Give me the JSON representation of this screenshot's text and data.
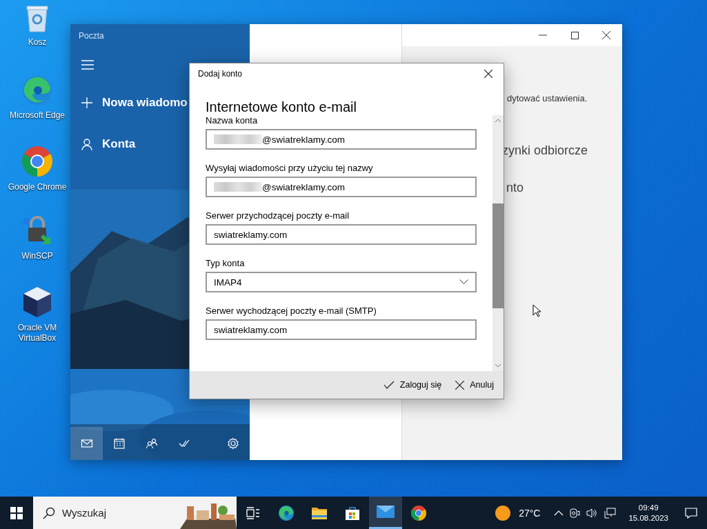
{
  "desktop_icons": [
    {
      "label": "Kosz",
      "kind": "bin"
    },
    {
      "label": "Microsoft Edge",
      "kind": "edge"
    },
    {
      "label": "Google Chrome",
      "kind": "chrome"
    },
    {
      "label": "WinSCP",
      "kind": "winscp"
    },
    {
      "label": "Oracle VM VirtualBox",
      "kind": "virtualbox"
    }
  ],
  "mail_window": {
    "title": "Poczta",
    "menu": [
      {
        "label": "Nowa wiadomo",
        "kind": "new"
      },
      {
        "label": "Konta",
        "kind": "accounts"
      }
    ],
    "nav": [
      {
        "kind": "mail",
        "selected": true
      },
      {
        "kind": "calendar",
        "selected": false
      },
      {
        "kind": "people",
        "selected": false
      },
      {
        "kind": "todo",
        "selected": false
      },
      {
        "kind": "settings",
        "selected": false
      }
    ],
    "right_texts": [
      "dytować ustawienia.",
      "zynki odbiorcze",
      "nto"
    ]
  },
  "dialog": {
    "title": "Dodaj konto",
    "heading": "Internetowe konto e-mail",
    "fields": [
      {
        "label": "Nazwa konta",
        "value": "@swiatreklamy.com",
        "redacted": true,
        "kind": "text"
      },
      {
        "label": "Wysyłaj wiadomości przy użyciu tej nazwy",
        "value": "@swiatreklamy.com",
        "redacted": true,
        "kind": "text"
      },
      {
        "label": "Serwer przychodzącej poczty e-mail",
        "value": "swiatreklamy.com",
        "redacted": false,
        "kind": "text"
      },
      {
        "label": "Typ konta",
        "value": "IMAP4",
        "redacted": false,
        "kind": "dropdown"
      },
      {
        "label": "Serwer wychodzącej poczty e-mail (SMTP)",
        "value": "swiatreklamy.com",
        "redacted": false,
        "kind": "text"
      }
    ],
    "buttons": [
      {
        "label": "Zaloguj się",
        "kind": "confirm"
      },
      {
        "label": "Anuluj",
        "kind": "cancel"
      }
    ]
  },
  "taskbar": {
    "search_placeholder": "Wyszukaj",
    "apps": [
      {
        "kind": "taskview",
        "selected": false
      },
      {
        "kind": "edge",
        "selected": false
      },
      {
        "kind": "explorer",
        "selected": false
      },
      {
        "kind": "store",
        "selected": false
      },
      {
        "kind": "mail",
        "selected": true
      },
      {
        "kind": "chrome",
        "selected": false
      }
    ],
    "weather": "27°C",
    "time": "09:49",
    "date": "15.08.2023"
  }
}
